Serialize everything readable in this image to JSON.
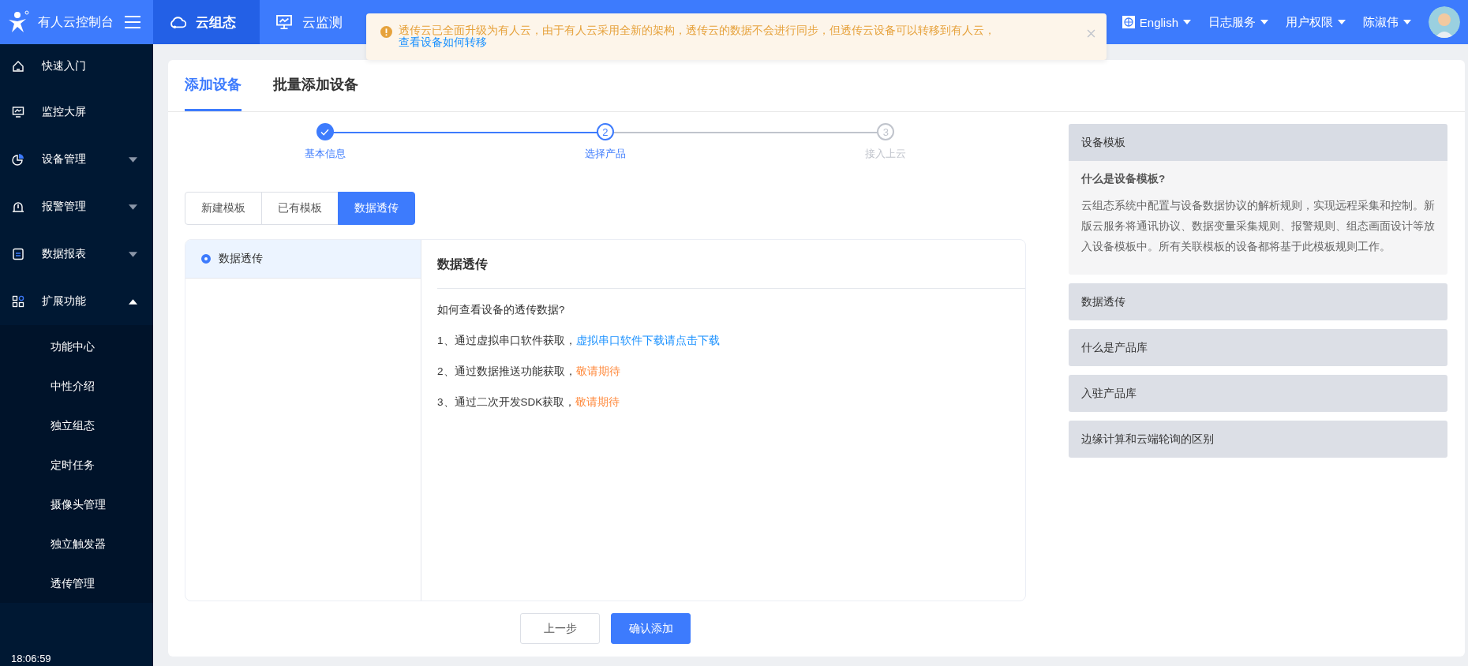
{
  "brand": {
    "title": "有人云控制台"
  },
  "top_nav": [
    {
      "label": "云组态",
      "selected": true
    },
    {
      "label": "云监测",
      "selected": false
    }
  ],
  "notice": {
    "text": "透传云已全面升级为有人云，由于有人云采用全新的架构，透传云的数据不会进行同步，但透传云设备可以转移到有人云，",
    "link": "查看设备如何转移"
  },
  "top_menu": [
    {
      "label": "English"
    },
    {
      "label": "日志服务"
    },
    {
      "label": "用户权限"
    },
    {
      "label": "陈淑伟"
    }
  ],
  "sidebar": {
    "items": [
      {
        "label": "快速入门"
      },
      {
        "label": "监控大屏"
      },
      {
        "label": "设备管理",
        "expanded": false
      },
      {
        "label": "报警管理",
        "expanded": false
      },
      {
        "label": "数据报表",
        "expanded": false
      },
      {
        "label": "扩展功能",
        "expanded": true,
        "children": [
          {
            "label": "功能中心"
          },
          {
            "label": "中性介绍"
          },
          {
            "label": "独立组态"
          },
          {
            "label": "定时任务"
          },
          {
            "label": "摄像头管理"
          },
          {
            "label": "独立触发器"
          },
          {
            "label": "透传管理"
          }
        ]
      }
    ]
  },
  "clock": "18:06:59",
  "tabs": [
    {
      "label": "添加设备",
      "selected": true
    },
    {
      "label": "批量添加设备",
      "selected": false
    }
  ],
  "steps": [
    {
      "label": "基本信息",
      "kind": "done"
    },
    {
      "label": "选择产品",
      "number": "2",
      "kind": "active"
    },
    {
      "label": "接入上云",
      "number": "3",
      "kind": "wait"
    }
  ],
  "segments": [
    {
      "label": "新建模板",
      "selected": false
    },
    {
      "label": "已有模板",
      "selected": false
    },
    {
      "label": "数据透传",
      "selected": true
    }
  ],
  "options": [
    {
      "label": "数据透传",
      "selected": true
    }
  ],
  "detail": {
    "title": "数据透传",
    "question": "如何查看设备的透传数据?",
    "lines": [
      {
        "text": "1、通过虚拟串口软件获取，",
        "action": "虚拟串口软件下载请点击下载",
        "kind": "link"
      },
      {
        "text": "2、通过数据推送功能获取，",
        "action": "敬请期待",
        "kind": "pending"
      },
      {
        "text": "3、通过二次开发SDK获取，",
        "action": "敬请期待",
        "kind": "pending"
      }
    ]
  },
  "buttons": [
    {
      "label": "上一步",
      "kind": "secondary"
    },
    {
      "label": "确认添加",
      "kind": "primary"
    }
  ],
  "help": [
    {
      "title": "设备模板",
      "expanded": true,
      "heading": "什么是设备模板?",
      "body": "云组态系统中配置与设备数据协议的解析规则，实现远程采集和控制。新版云服务将通讯协议、数据变量采集规则、报警规则、组态画面设计等放入设备模板中。所有关联模板的设备都将基于此模板规则工作。"
    },
    {
      "title": "数据透传",
      "expanded": false
    },
    {
      "title": "什么是产品库",
      "expanded": false
    },
    {
      "title": "入驻产品库",
      "expanded": false
    },
    {
      "title": "边缘计算和云端轮询的区别",
      "expanded": false
    }
  ]
}
